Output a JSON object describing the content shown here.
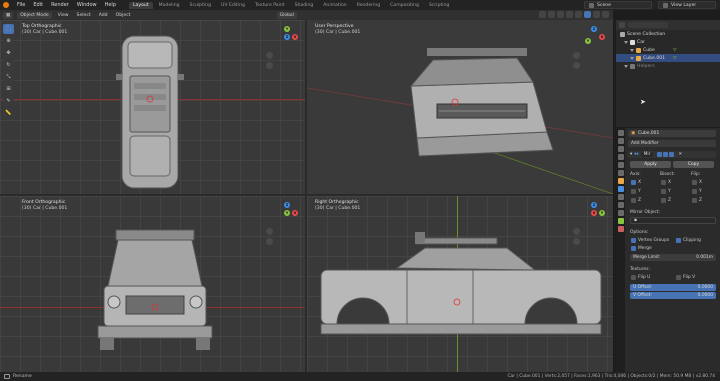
{
  "menu": [
    "File",
    "Edit",
    "Render",
    "Window",
    "Help"
  ],
  "workspaces": [
    "Layout",
    "Modeling",
    "Sculpting",
    "UV Editing",
    "Texture Paint",
    "Shading",
    "Animation",
    "Rendering",
    "Compositing",
    "Scripting"
  ],
  "active_workspace": "Layout",
  "scene": "Scene",
  "view_layer": "View Layer",
  "viewport_header": {
    "mode": "Object Mode",
    "menus": [
      "View",
      "Select",
      "Add",
      "Object"
    ],
    "orientation": "Global"
  },
  "toolbar_icons": [
    "select-box-icon",
    "cursor-icon",
    "move-icon",
    "rotate-icon",
    "scale-icon",
    "transform-icon",
    "annotate-icon",
    "measure-icon"
  ],
  "viewports": [
    {
      "title": "Top Orthographic",
      "sub": "(30) Car | Cube.001"
    },
    {
      "title": "User Perspective",
      "sub": "(30) Car | Cube.001"
    },
    {
      "title": "Front Orthographic",
      "sub": "(30) Car | Cube.001"
    },
    {
      "title": "Right Orthographic",
      "sub": "(30) Car | Cube.001"
    }
  ],
  "outliner": {
    "root": "Scene Collection",
    "items": [
      {
        "label": "Car",
        "level": 1,
        "selected": false
      },
      {
        "label": "Cube",
        "level": 2,
        "selected": false
      },
      {
        "label": "Cube.001",
        "level": 2,
        "selected": true
      },
      {
        "label": "Helpers",
        "level": 1,
        "selected": false
      }
    ]
  },
  "properties": {
    "object_name": "Cube.001",
    "add_modifier": "Add Modifier",
    "modifier_name": "Mir",
    "apply": "Apply",
    "copy": "Copy",
    "axis_label": "Axis:",
    "bisect_label": "Bisect:",
    "flip_label": "Flip:",
    "axes": [
      "X",
      "Y",
      "Z"
    ],
    "mirror_object": "Mirror Object:",
    "options": "Options:",
    "vertex_groups": "Vertex Groups",
    "clipping": "Clipping",
    "merge": "Merge",
    "merge_limit_label": "Merge Limit:",
    "merge_limit_value": "0.001m",
    "textures": "Textures:",
    "flip_u": "Flip U",
    "flip_v": "Flip V",
    "u_offset_label": "U Offset:",
    "u_offset_value": "0.0000",
    "v_offset_label": "V Offset:",
    "v_offset_value": "0.0000"
  },
  "status": {
    "left": "Rename",
    "right": "Car | Cube.001 | Verts:2,057 | Faces:1,963 | Tris:4,046 | Objects:0/2 | Mem: 50.9 MB | v2.80.74"
  },
  "colors": {
    "accent": "#4772b3",
    "active_outline": "#e87d0d",
    "gizmo_x": "#e84b4b",
    "gizmo_y": "#8ac53f",
    "gizmo_z": "#3c8ee8"
  }
}
